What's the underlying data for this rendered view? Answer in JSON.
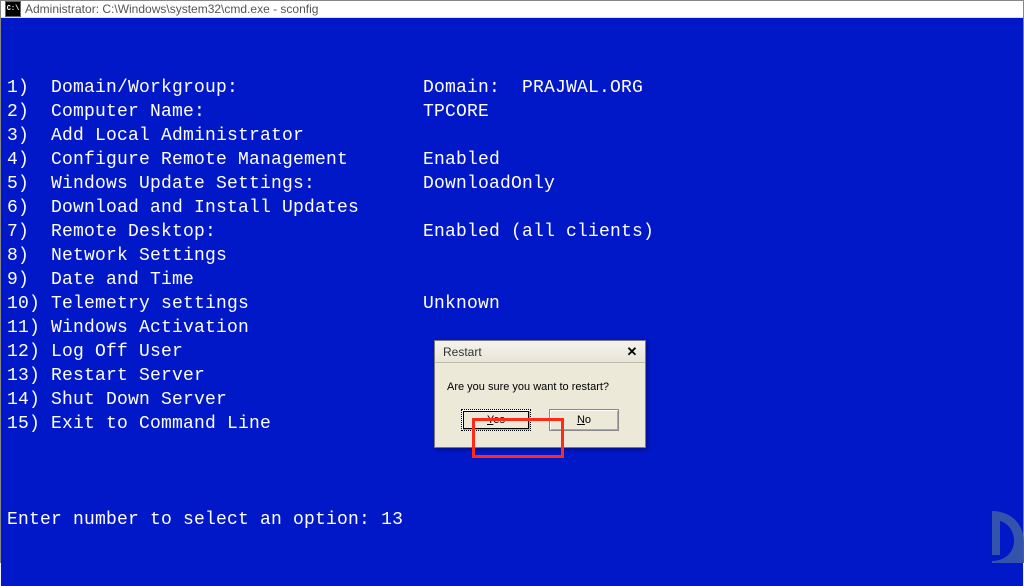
{
  "titlebar": {
    "icon_abbrev": "C:\\",
    "text": "Administrator: C:\\Windows\\system32\\cmd.exe - sconfig"
  },
  "menu": {
    "items": [
      {
        "num": "1)",
        "label": "Domain/Workgroup:",
        "value": "Domain:  PRAJWAL.ORG"
      },
      {
        "num": "2)",
        "label": "Computer Name:",
        "value": "TPCORE"
      },
      {
        "num": "3)",
        "label": "Add Local Administrator",
        "value": ""
      },
      {
        "num": "4)",
        "label": "Configure Remote Management",
        "value": "Enabled"
      },
      {
        "num": "",
        "label": "",
        "value": ""
      },
      {
        "num": "5)",
        "label": "Windows Update Settings:",
        "value": "DownloadOnly"
      },
      {
        "num": "6)",
        "label": "Download and Install Updates",
        "value": ""
      },
      {
        "num": "7)",
        "label": "Remote Desktop:",
        "value": "Enabled (all clients)"
      },
      {
        "num": "",
        "label": "",
        "value": ""
      },
      {
        "num": "8)",
        "label": "Network Settings",
        "value": ""
      },
      {
        "num": "9)",
        "label": "Date and Time",
        "value": ""
      },
      {
        "num": "10)",
        "label": "Telemetry settings",
        "value": "Unknown"
      },
      {
        "num": "11)",
        "label": "Windows Activation",
        "value": ""
      },
      {
        "num": "",
        "label": "",
        "value": ""
      },
      {
        "num": "12)",
        "label": "Log Off User",
        "value": ""
      },
      {
        "num": "13)",
        "label": "Restart Server",
        "value": ""
      },
      {
        "num": "14)",
        "label": "Shut Down Server",
        "value": ""
      },
      {
        "num": "15)",
        "label": "Exit to Command Line",
        "value": ""
      }
    ]
  },
  "prompt": {
    "label": "Enter number to select an option: ",
    "input": "13"
  },
  "dialog": {
    "title": "Restart",
    "message": "Are you sure you want to restart?",
    "yes_label": "Yes",
    "no_label": "No",
    "close_glyph": "✕"
  }
}
